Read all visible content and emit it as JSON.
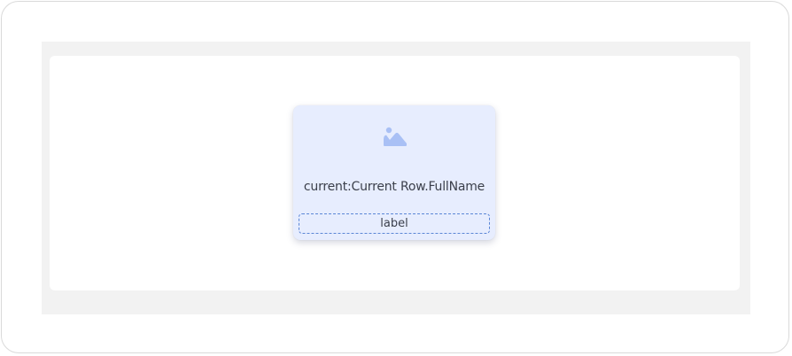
{
  "card": {
    "icon": "image-icon",
    "title": "current:Current Row.FullName",
    "label": "label"
  },
  "colors": {
    "card_background": "#e7edfe",
    "icon": "#a9c0f5",
    "label_border": "#5b86d6",
    "canvas": "#f2f2f2"
  }
}
